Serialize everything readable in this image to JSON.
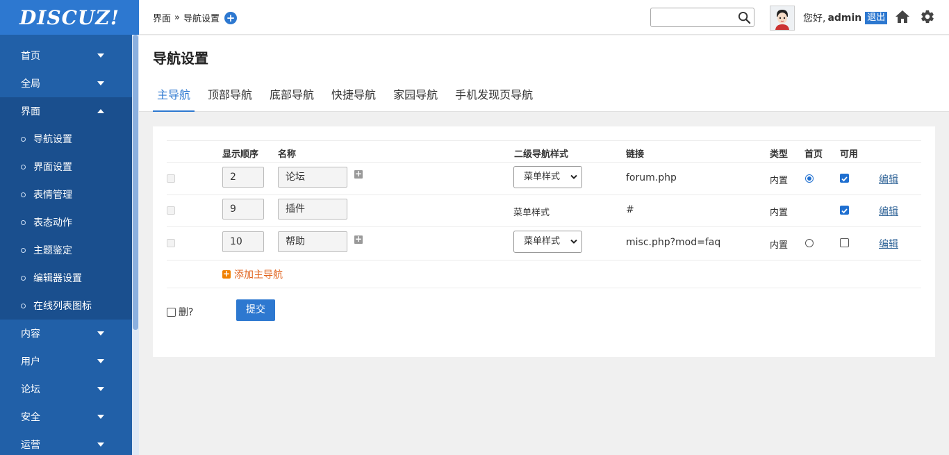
{
  "logo": "DISCUZ!",
  "sidebar": {
    "items": [
      {
        "label": "首页"
      },
      {
        "label": "全局"
      },
      {
        "label": "界面"
      },
      {
        "label": "内容"
      },
      {
        "label": "用户"
      },
      {
        "label": "论坛"
      },
      {
        "label": "安全"
      },
      {
        "label": "运营"
      }
    ],
    "submenu": [
      {
        "label": "导航设置"
      },
      {
        "label": "界面设置"
      },
      {
        "label": "表情管理"
      },
      {
        "label": "表态动作"
      },
      {
        "label": "主题鉴定"
      },
      {
        "label": "编辑器设置"
      },
      {
        "label": "在线列表图标"
      }
    ]
  },
  "header": {
    "breadcrumb": {
      "parent": "界面",
      "sep": "»",
      "current": "导航设置"
    },
    "search_value": "",
    "greeting": "您好,",
    "username": "admin",
    "logout": "退出"
  },
  "page": {
    "title": "导航设置",
    "tabs": [
      "主导航",
      "顶部导航",
      "底部导航",
      "快捷导航",
      "家园导航",
      "手机发现页导航"
    ]
  },
  "table": {
    "headers": {
      "order": "显示顺序",
      "name": "名称",
      "subnav_style": "二级导航样式",
      "link": "链接",
      "type": "类型",
      "home": "首页",
      "enabled": "可用"
    },
    "rows": [
      {
        "order": "2",
        "name": "论坛",
        "style": "菜单样式",
        "style_is_select": true,
        "link": "forum.php",
        "type": "内置",
        "home": true,
        "enabled": true,
        "edit": "编辑"
      },
      {
        "order": "9",
        "name": "插件",
        "style": "菜单样式",
        "style_is_select": false,
        "link": "#",
        "type": "内置",
        "home": null,
        "enabled": true,
        "edit": "编辑"
      },
      {
        "order": "10",
        "name": "帮助",
        "style": "菜单样式",
        "style_is_select": true,
        "link": "misc.php?mod=faq",
        "type": "内置",
        "home": false,
        "enabled": false,
        "edit": "编辑"
      }
    ],
    "add_label": "添加主导航",
    "delete_label": "删?",
    "submit_label": "提交"
  },
  "colors": {
    "accent": "#2d78d0",
    "sidebar": "#2160a8",
    "add_link": "#e0621c"
  }
}
